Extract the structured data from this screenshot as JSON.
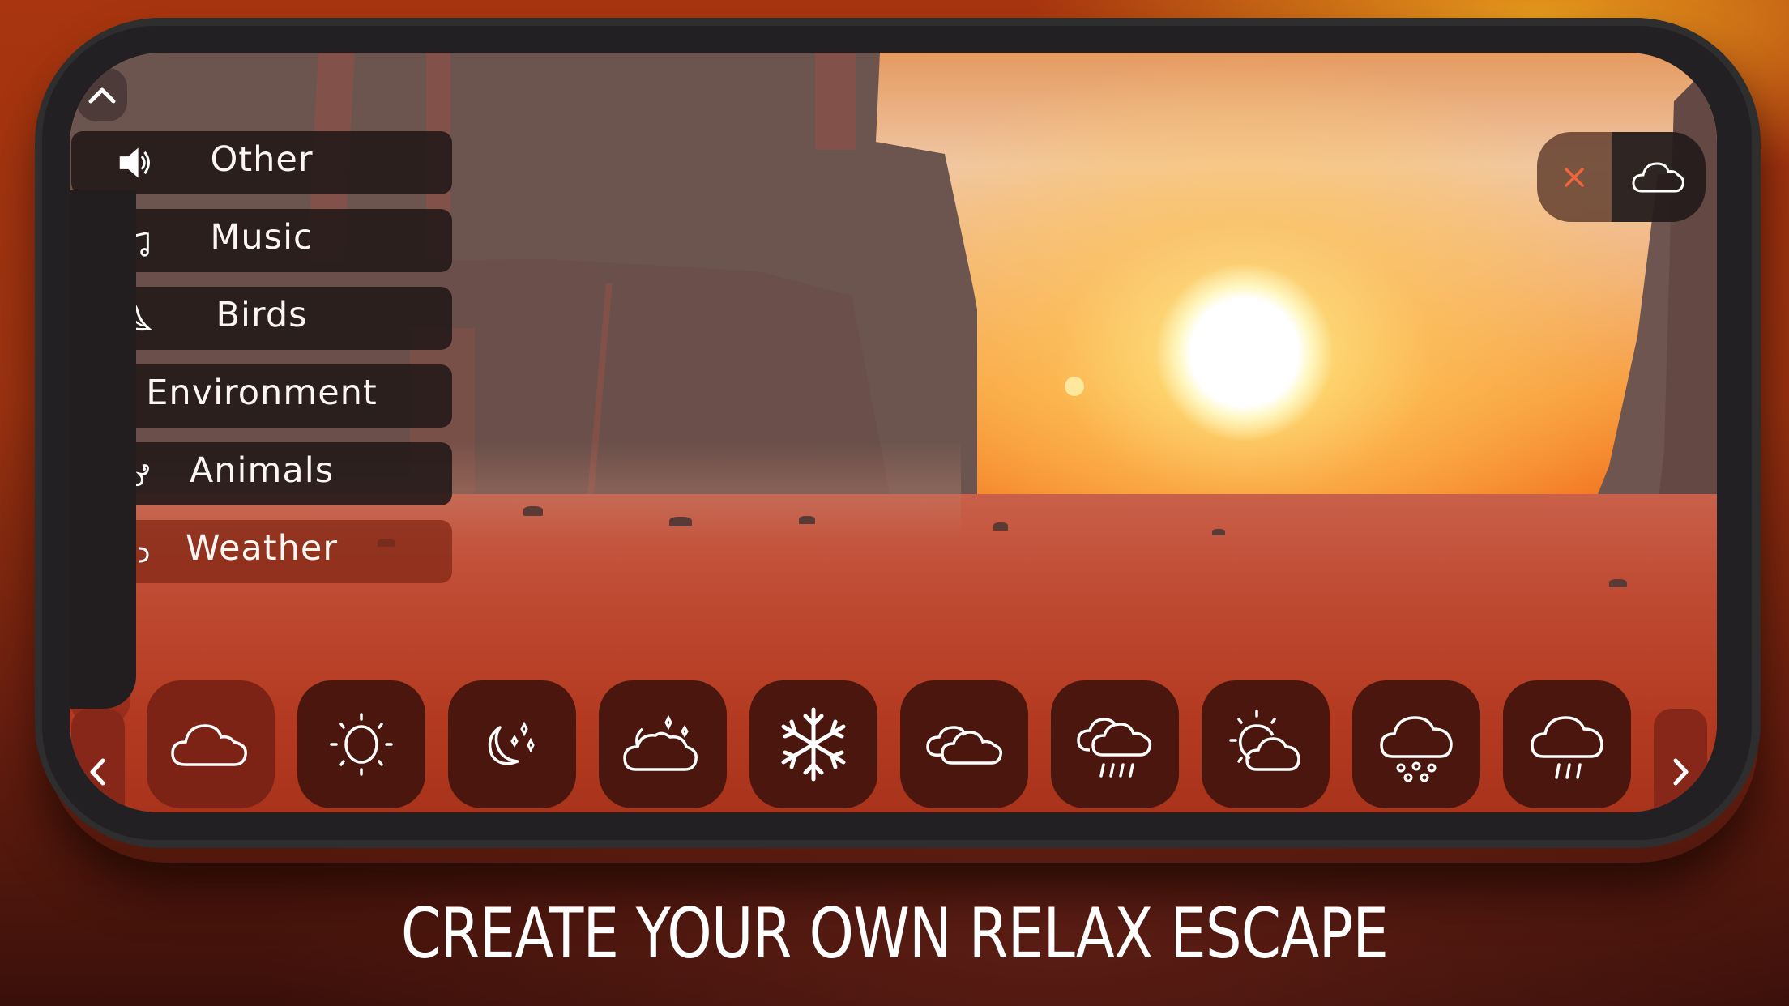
{
  "app": {
    "caption": "CREATE YOUR OWN RELAX ESCAPE"
  },
  "menu": {
    "collapse_icon": "chevron-up-icon",
    "items": [
      {
        "label": "Other",
        "icon": "speaker-icon",
        "active": false
      },
      {
        "label": "Music",
        "icon": "music-notes-icon",
        "active": false
      },
      {
        "label": "Birds",
        "icon": "bird-icon",
        "active": false
      },
      {
        "label": "Environment",
        "icon": "environment-icon",
        "active": false
      },
      {
        "label": "Animals",
        "icon": "animal-icon",
        "active": false
      },
      {
        "label": "Weather",
        "icon": "weather-icon",
        "active": true
      }
    ]
  },
  "active_sound": {
    "remove_icon": "close-icon",
    "sound_icon": "cloud-icon",
    "remove_color": "#f2653a"
  },
  "weather_bar": {
    "prev_icon": "chevron-left-icon",
    "next_icon": "chevron-right-icon",
    "tiles": [
      {
        "name": "cloud",
        "icon": "cloud-icon",
        "selected": true
      },
      {
        "name": "sun",
        "icon": "sun-icon",
        "selected": false
      },
      {
        "name": "clear-night",
        "icon": "moon-stars-icon",
        "selected": false
      },
      {
        "name": "cloudy-night",
        "icon": "moon-cloud-icon",
        "selected": false
      },
      {
        "name": "snow",
        "icon": "snowflake-icon",
        "selected": false
      },
      {
        "name": "overcast",
        "icon": "clouds-icon",
        "selected": false
      },
      {
        "name": "heavy-rain",
        "icon": "clouds-rain-icon",
        "selected": false
      },
      {
        "name": "partly-cloudy",
        "icon": "sun-cloud-icon",
        "selected": false
      },
      {
        "name": "hail",
        "icon": "cloud-hail-icon",
        "selected": false
      },
      {
        "name": "rain",
        "icon": "cloud-rain-icon",
        "selected": false
      }
    ]
  },
  "colors": {
    "accent_close": "#f2653a",
    "tile_bg": "#4a160d",
    "tile_selected_bg": "#7d2315",
    "menu_bg": "#231918",
    "phone_frame": "#2e2e2f"
  }
}
